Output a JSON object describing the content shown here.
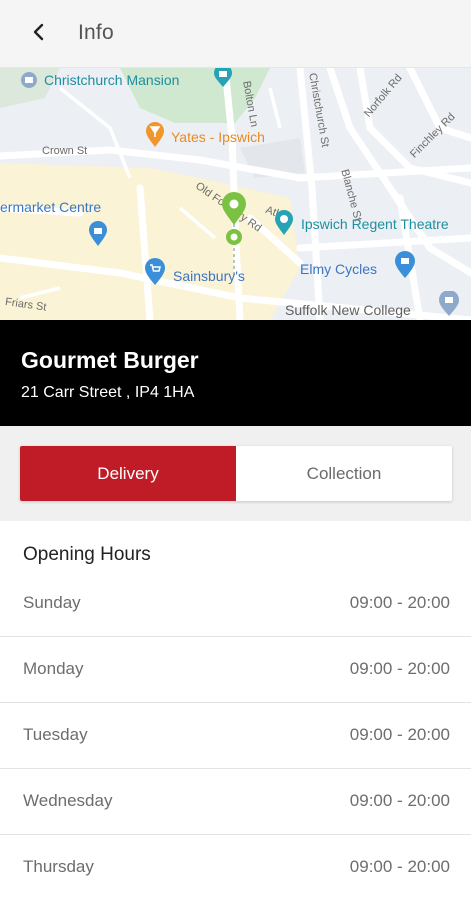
{
  "header": {
    "title": "Info",
    "back_icon": "chevron-left-icon"
  },
  "map": {
    "labels": {
      "christchurch_mansion": "Christchurch Mansion",
      "yates": "Yates - Ipswich",
      "crown_st": "Crown St",
      "bolton_ln": "Bolton Ln",
      "christchurch_st": "Christchurch St",
      "norfolk_rd": "Norfolk Rd",
      "finchley_rd": "Finchley Rd",
      "market_centre": "ermarket Centre",
      "old_foundry_rd": "Old Foundry Rd",
      "ipswich_regent": "Ipswich Regent Theatre",
      "blanche_st": "Blanche St",
      "elmy_cycles": "Elmy Cycles",
      "sainsburys": "Sainsbury's",
      "friars_st": "Friars St",
      "suffolk_new_college": "Suffolk New College",
      "atlas": "Atlas"
    },
    "colors": {
      "pin_green": "#7cc242",
      "road_bg": "#eceff3",
      "park": "#c8e6c9",
      "area": "#fbf3d6"
    }
  },
  "restaurant": {
    "name": "Gourmet Burger",
    "address": "21 Carr Street , IP4 1HA"
  },
  "order_type": {
    "delivery": "Delivery",
    "collection": "Collection",
    "selected": "Delivery",
    "accent_color": "#c01c28"
  },
  "hours": {
    "title": "Opening Hours",
    "days": [
      {
        "day": "Sunday",
        "time": "09:00 - 20:00"
      },
      {
        "day": "Monday",
        "time": "09:00 - 20:00"
      },
      {
        "day": "Tuesday",
        "time": "09:00 - 20:00"
      },
      {
        "day": "Wednesday",
        "time": "09:00 - 20:00"
      },
      {
        "day": "Thursday",
        "time": "09:00 - 20:00"
      }
    ]
  }
}
